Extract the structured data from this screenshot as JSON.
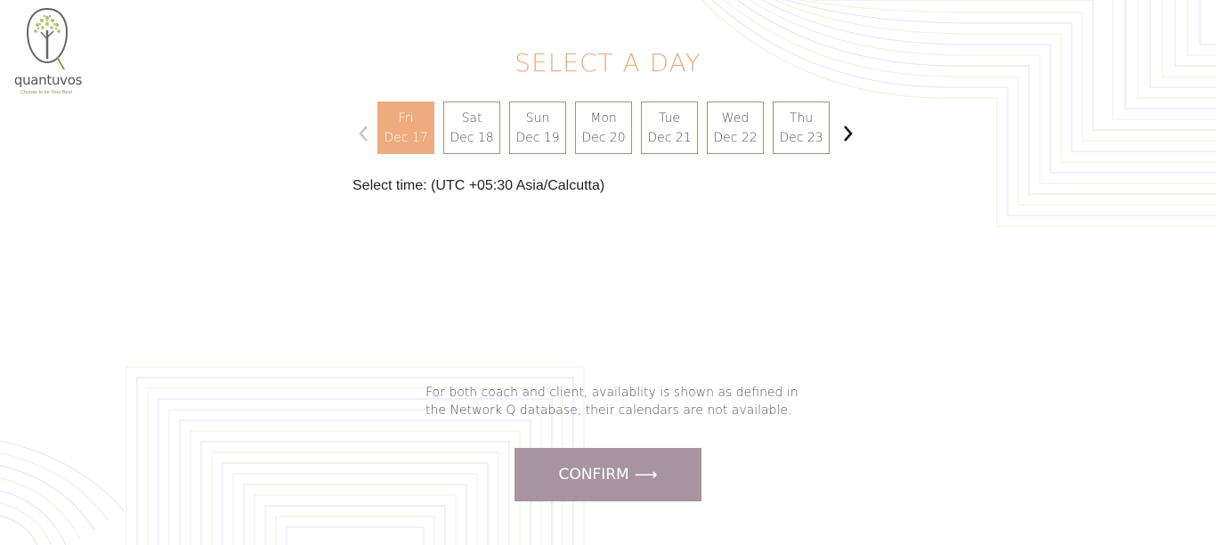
{
  "brand": {
    "name": "quantuvos",
    "tagline": "Choose to be Your Best"
  },
  "title": "SELECT A DAY",
  "days": [
    {
      "day": "Fri",
      "date": "Dec 17",
      "selected": true
    },
    {
      "day": "Sat",
      "date": "Dec 18",
      "selected": false
    },
    {
      "day": "Sun",
      "date": "Dec 19",
      "selected": false
    },
    {
      "day": "Mon",
      "date": "Dec 20",
      "selected": false
    },
    {
      "day": "Tue",
      "date": "Dec 21",
      "selected": false
    },
    {
      "day": "Wed",
      "date": "Dec 22",
      "selected": false
    },
    {
      "day": "Thu",
      "date": "Dec 23",
      "selected": false
    }
  ],
  "nav": {
    "prev_icon": "chevron-left-icon",
    "next_icon": "chevron-right-icon"
  },
  "timezone_label": "Select time: (UTC +05:30 Asia/Calcutta)",
  "note": "For both coach and client, availablity is shown as defined in the Network Q database, their calendars are not available.",
  "confirm": {
    "label": "CONFIRM",
    "icon": "arrow-right-icon"
  },
  "colors": {
    "accent": "#eeab7e",
    "confirm_bg": "#a794a0",
    "day_border": "#8aa07a",
    "brand_green": "#7da44a"
  }
}
